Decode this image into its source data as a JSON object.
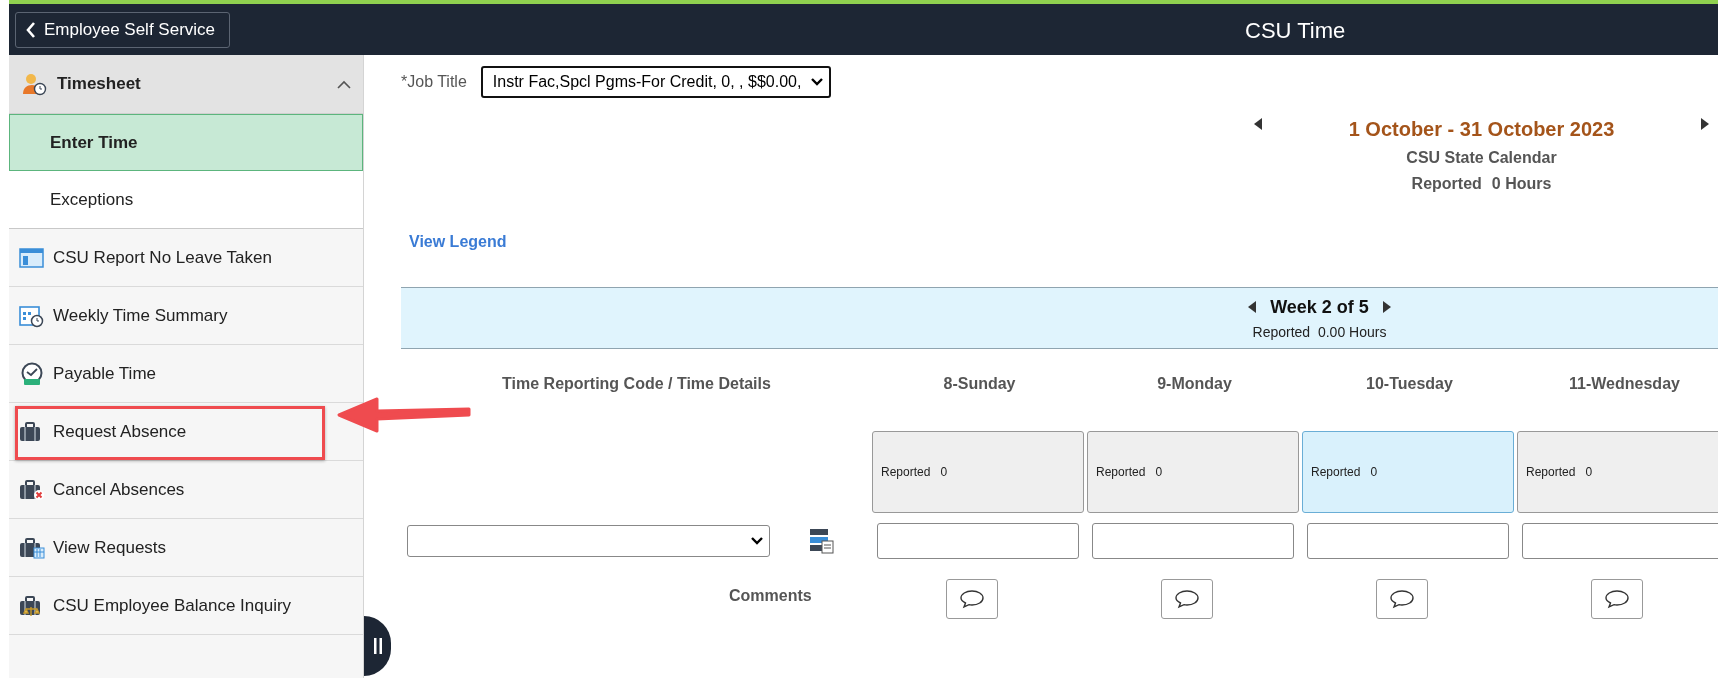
{
  "header": {
    "back_button": "Employee Self Service",
    "title": "CSU Time"
  },
  "sidebar": {
    "section": {
      "label": "Timesheet",
      "expanded": true
    },
    "sub_items": [
      {
        "label": "Enter Time",
        "selected": true
      },
      {
        "label": "Exceptions",
        "selected": false
      }
    ],
    "items": [
      {
        "label": "CSU Report No Leave Taken",
        "kind": "report",
        "highlighted": false
      },
      {
        "label": "Weekly Time Summary",
        "kind": "calendar",
        "highlighted": false
      },
      {
        "label": "Payable Time",
        "kind": "clock",
        "highlighted": false
      },
      {
        "label": "Request Absence",
        "kind": "briefcase",
        "highlighted": true
      },
      {
        "label": "Cancel Absences",
        "kind": "briefcase-cancel",
        "highlighted": false
      },
      {
        "label": "View Requests",
        "kind": "briefcase-calendar",
        "highlighted": false
      },
      {
        "label": "CSU Employee Balance Inquiry",
        "kind": "briefcase-balance",
        "highlighted": false
      }
    ]
  },
  "job_title": {
    "label": "*Job Title",
    "value": "Instr Fac,Spcl Pgms-For Credit, 0, , $$0.00,"
  },
  "period": {
    "range": "1 October - 31 October 2023",
    "calendar": "CSU State Calendar",
    "reported_label": "Reported",
    "reported_value": "0 Hours"
  },
  "view_legend": "View Legend",
  "week": {
    "label": "Week 2 of 5",
    "reported": "Reported  0.00 Hours"
  },
  "grid": {
    "column_header": "Time Reporting Code / Time Details",
    "comments_label": "Comments",
    "days": [
      {
        "label": "8-Sunday",
        "reported_label": "Reported",
        "reported_value": "0",
        "selected": false
      },
      {
        "label": "9-Monday",
        "reported_label": "Reported",
        "reported_value": "0",
        "selected": false
      },
      {
        "label": "10-Tuesday",
        "reported_label": "Reported",
        "reported_value": "0",
        "selected": true
      },
      {
        "label": "11-Wednesday",
        "reported_label": "Reported",
        "reported_value": "0",
        "selected": false
      }
    ]
  }
}
